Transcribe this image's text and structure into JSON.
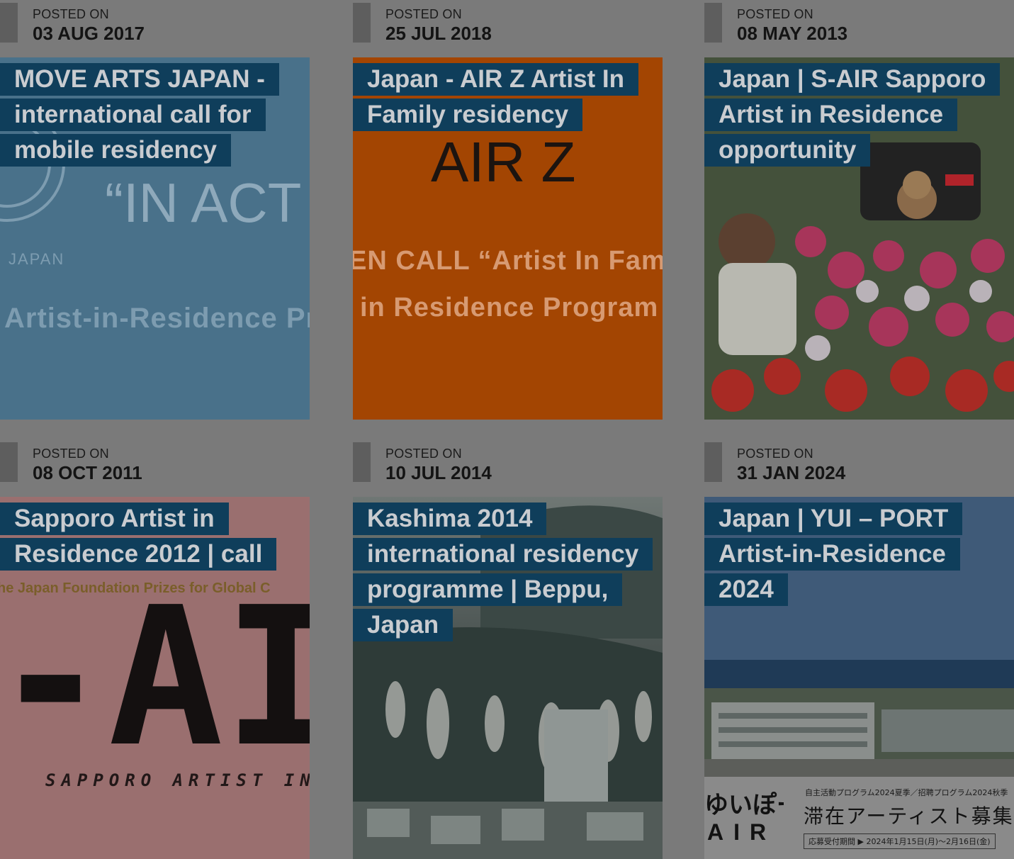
{
  "posted_label": "POSTED ON",
  "cards": [
    {
      "date": "03 AUG 2017",
      "title": "MOVE ARTS JAPAN - international call for mobile residency",
      "image_text": {
        "line1": "“IN ACT",
        "line2": "JAPAN",
        "line3": "Artist-in-Residence Pr"
      }
    },
    {
      "date": "25 JUL 2018",
      "title": "Japan - AIR Z Artist In Family residency",
      "image_text": {
        "logo": "AIR Z",
        "line1": "EN CALL “Artist In Fam",
        "line2": "in Residence Program"
      }
    },
    {
      "date": "08 MAY 2013",
      "title": "Japan | S-AIR Sapporo Artist in Residence opportunity",
      "image_text": {}
    },
    {
      "date": "08 OCT 2011",
      "title": "Sapporo Artist in Residence 2012 | call",
      "image_text": {
        "line1": "he Japan Foundation Prizes for Global C",
        "logo": "-AI",
        "line2": "SAPPORO ARTIST IN"
      }
    },
    {
      "date": "10 JUL 2014",
      "title": "Kashima 2014 international residency programme | Beppu, Japan",
      "image_text": {}
    },
    {
      "date": "31 JAN 2024",
      "title": "Japan | YUI – PORT Artist-in-Residence 2024",
      "image_text": {
        "logo": "ゆいぽーと",
        "logo_sub": "AIR",
        "line1": "自主活動プログラム2024夏季／招聘プログラム2024秋季",
        "line2": "滞在アーティスト募集",
        "line3": "応募受付期間 ▶ 2024年1月15日(月)〜2月16日(金)"
      }
    }
  ]
}
